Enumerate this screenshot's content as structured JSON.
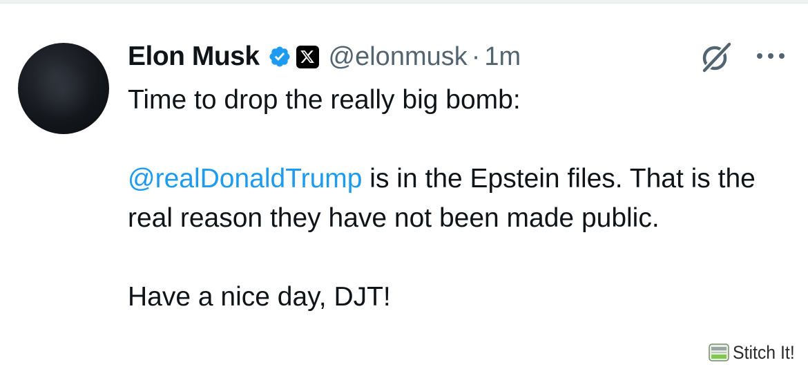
{
  "tweet": {
    "author": {
      "display_name": "Elon Musk",
      "handle": "@elonmusk",
      "verified": true,
      "affiliation_badge": "X"
    },
    "separator": "·",
    "timestamp": "1m",
    "text": {
      "line1": "Time to drop the really big bomb:",
      "mention": "@realDonaldTrump",
      "line2_rest": " is in the Epstein files. That is the real reason they have not been made public.",
      "line3": "Have a nice day, DJT!"
    },
    "icons": {
      "grok": "grok-icon",
      "more": "more-options-icon",
      "verified": "verified-badge-icon"
    }
  },
  "watermark": {
    "label": "Stitch It!"
  },
  "colors": {
    "mention": "#1d9bf0",
    "verified": "#1d9bf0",
    "secondary_text": "#536471",
    "primary_text": "#0f1419"
  }
}
